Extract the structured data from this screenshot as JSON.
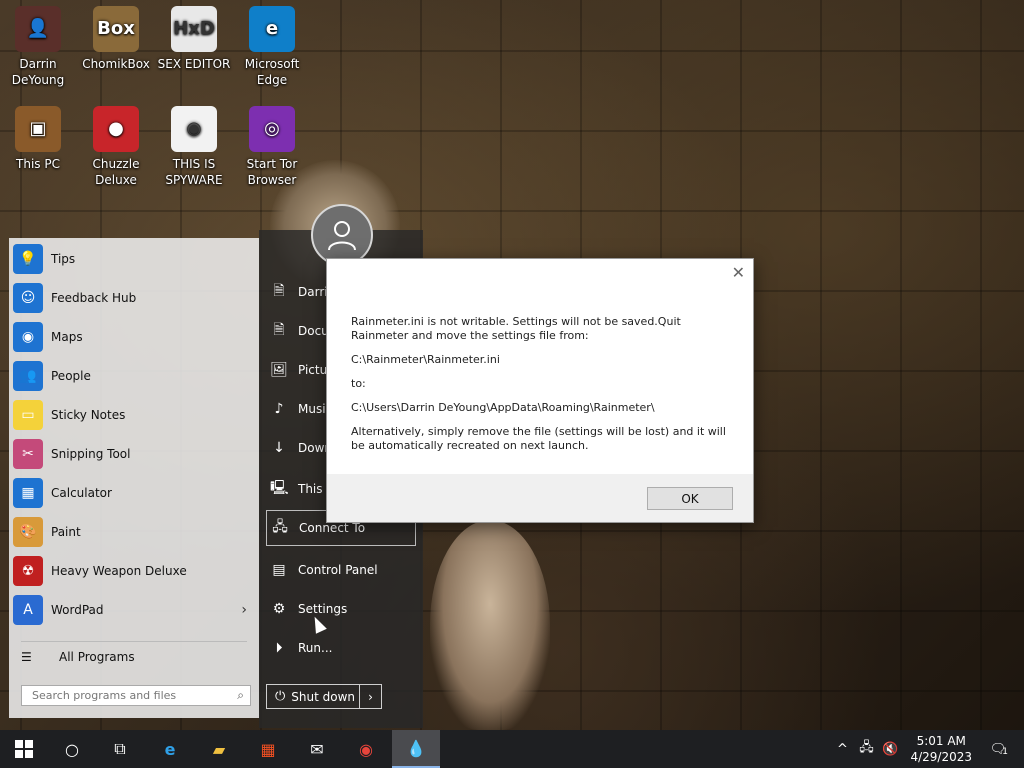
{
  "desktop": {
    "icons": [
      {
        "label": "Darrin DeYoung",
        "glyph": "👤",
        "color": "#5a2f2a"
      },
      {
        "label": "ChomikBox",
        "glyph": "Box",
        "color": "#8a6a3a"
      },
      {
        "label": "SEX EDITOR",
        "glyph": "HxD",
        "color": "#e8e8e8"
      },
      {
        "label": "Microsoft Edge",
        "glyph": "e",
        "color": "#0f7fc9"
      },
      {
        "label": "This PC",
        "glyph": "▣",
        "color": "#8a5a2a"
      },
      {
        "label": "Chuzzle Deluxe",
        "glyph": "●",
        "color": "#c8252a"
      },
      {
        "label": "THIS IS SPYWARE",
        "glyph": "◉",
        "color": "#f2f2f2"
      },
      {
        "label": "Start Tor Browser",
        "glyph": "◎",
        "color": "#7d2fb0"
      }
    ]
  },
  "start_menu": {
    "programs": [
      {
        "label": "Tips",
        "glyph": "💡",
        "color": "#1e73d1"
      },
      {
        "label": "Feedback Hub",
        "glyph": "☺",
        "color": "#1e73d1"
      },
      {
        "label": "Maps",
        "glyph": "◉",
        "color": "#1e73d1"
      },
      {
        "label": "People",
        "glyph": "👥",
        "color": "#1e73d1"
      },
      {
        "label": "Sticky Notes",
        "glyph": "▭",
        "color": "#f4d23a"
      },
      {
        "label": "Snipping Tool",
        "glyph": "✂",
        "color": "#c44a7a"
      },
      {
        "label": "Calculator",
        "glyph": "▦",
        "color": "#1e73d1"
      },
      {
        "label": "Paint",
        "glyph": "🎨",
        "color": "#d89a3a"
      },
      {
        "label": "Heavy Weapon Deluxe",
        "glyph": "☢",
        "color": "#c02020"
      },
      {
        "label": "WordPad",
        "glyph": "A",
        "color": "#2a6ad1"
      }
    ],
    "all_programs": "All Programs",
    "search_placeholder": "Search programs and files",
    "places": [
      {
        "label": "Darrin DeYoung",
        "glyph": "🗎"
      },
      {
        "label": "Documents",
        "glyph": "🗎"
      },
      {
        "label": "Pictures",
        "glyph": "🖼"
      },
      {
        "label": "Music",
        "glyph": "♪"
      },
      {
        "label": "Downloads",
        "glyph": "↓"
      },
      {
        "label": "This PC",
        "glyph": "🖳"
      },
      {
        "label": "Connect To",
        "glyph": "🖧"
      },
      {
        "label": "Control Panel",
        "glyph": "▤"
      },
      {
        "label": "Settings",
        "glyph": "⚙"
      },
      {
        "label": "Run...",
        "glyph": "⏵"
      }
    ],
    "shutdown": "Shut down"
  },
  "dialog": {
    "line1": "Rainmeter.ini is not writable. Settings will not be saved.Quit Rainmeter and move the settings file from:",
    "line2": "C:\\Rainmeter\\Rainmeter.ini",
    "line3": "to:",
    "line4": "C:\\Users\\Darrin DeYoung\\AppData\\Roaming\\Rainmeter\\",
    "line5": "Alternatively, simply remove the file (settings will be lost) and it will be automatically recreated on next launch.",
    "ok": "OK"
  },
  "taskbar": {
    "time": "5:01 AM",
    "date": "4/29/2023",
    "notification_count": "1"
  }
}
